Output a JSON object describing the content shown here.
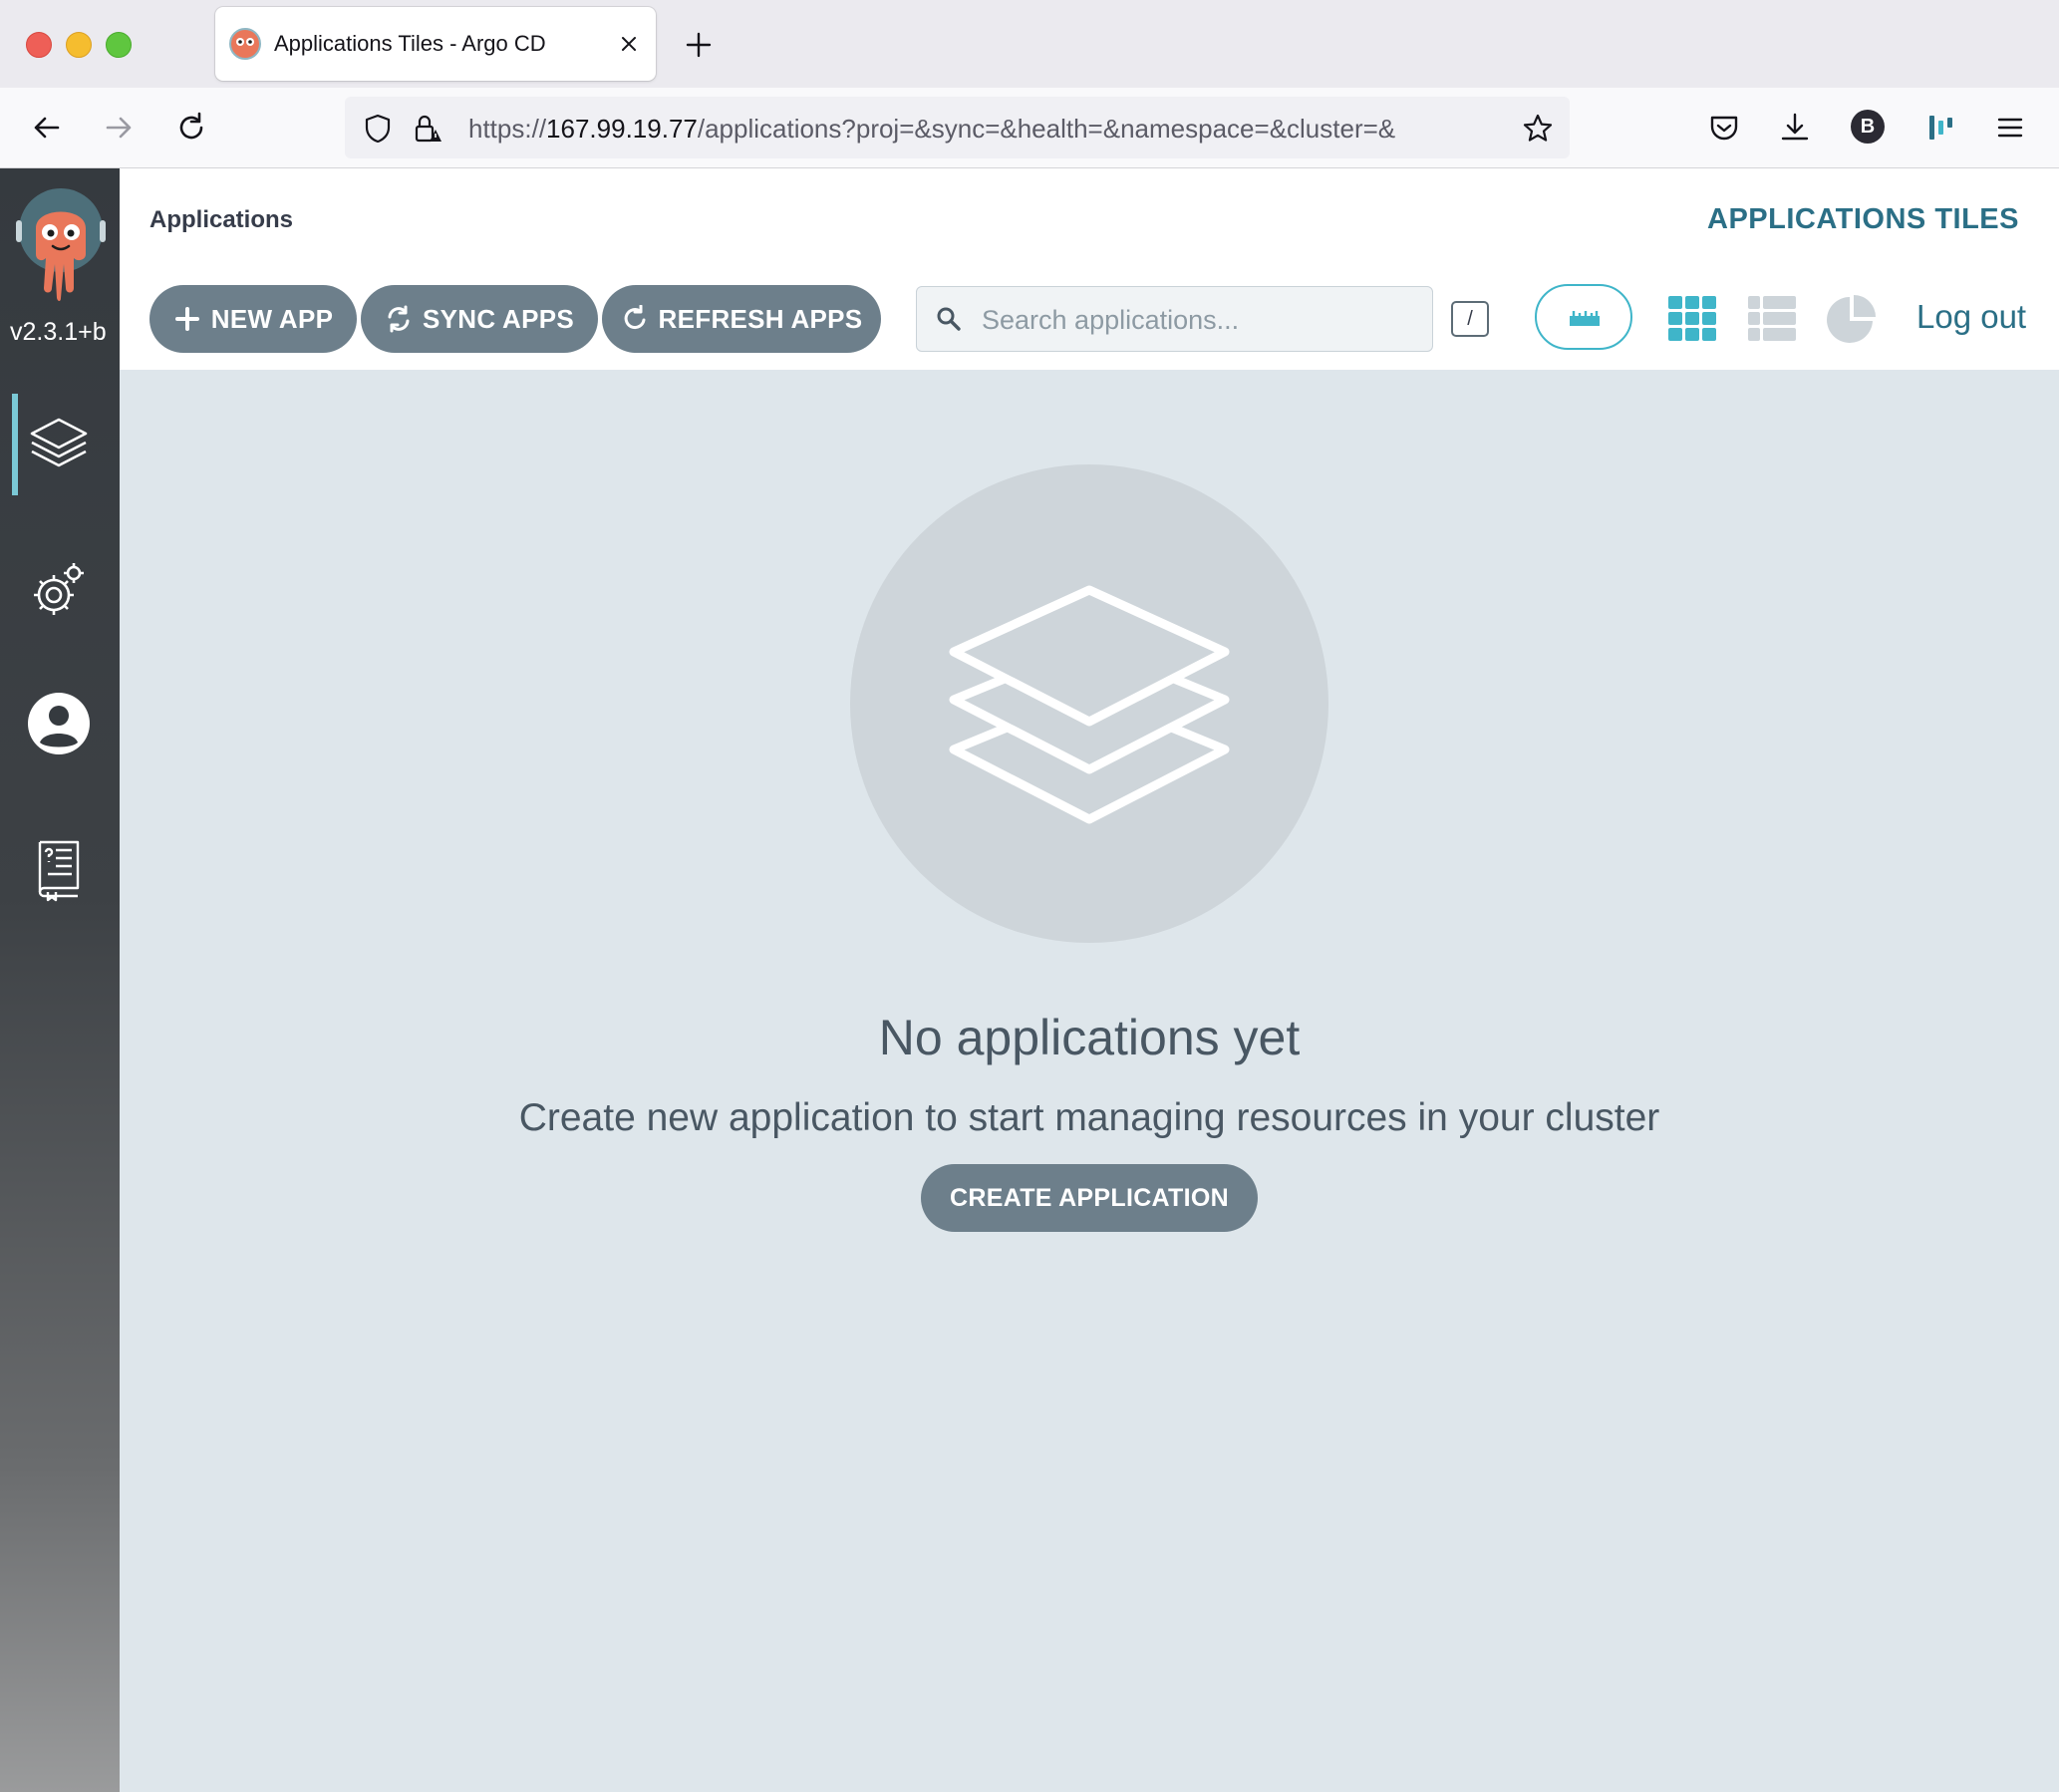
{
  "browser": {
    "tab_title": "Applications Tiles - Argo CD",
    "url_prefix": "https://",
    "url_host": "167.99.19.77",
    "url_path": "/applications?proj=&sync=&health=&namespace=&cluster=&",
    "profile_initial": "B"
  },
  "sidebar": {
    "version": "v2.3.1+b",
    "items": [
      {
        "icon": "layers-icon",
        "active": true
      },
      {
        "icon": "gear-icon",
        "active": false
      },
      {
        "icon": "user-icon",
        "active": false
      },
      {
        "icon": "docs-icon",
        "active": false
      }
    ]
  },
  "header": {
    "breadcrumb": "Applications",
    "title": "APPLICATIONS TILES"
  },
  "toolbar": {
    "new_app": "NEW APP",
    "sync_apps": "SYNC APPS",
    "refresh_apps": "REFRESH APPS",
    "search_placeholder": "Search applications...",
    "search_shortcut": "/",
    "logout": "Log out",
    "views": [
      "tiles-view-icon",
      "list-view-icon",
      "summary-view-icon"
    ]
  },
  "empty_state": {
    "title": "No applications yet",
    "subtitle": "Create new application to start managing resources in your cluster",
    "create_button": "CREATE APPLICATION"
  },
  "colors": {
    "accent": "#2b6f86",
    "teal": "#3fb5c9",
    "button": "#6d7f8b",
    "background": "#dee6eb"
  }
}
